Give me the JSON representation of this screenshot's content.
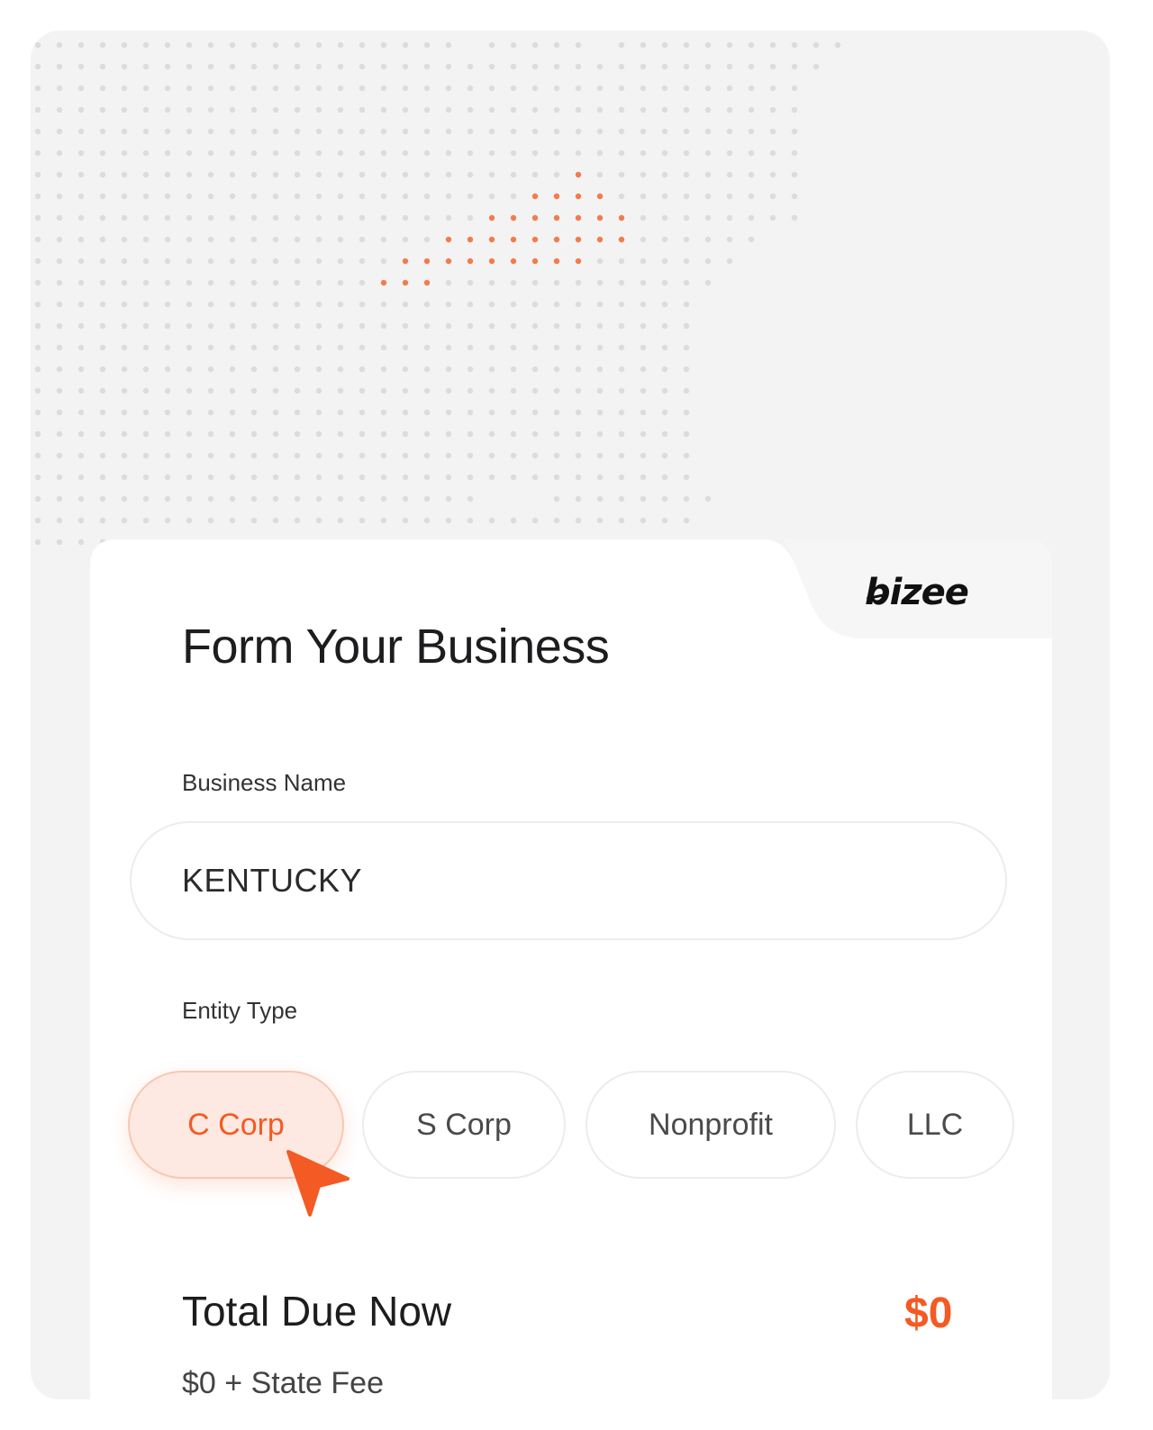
{
  "brand": {
    "logo_text": "bizee"
  },
  "form": {
    "title": "Form Your Business",
    "business_name_label": "Business Name",
    "business_name_value": "KENTUCKY",
    "entity_type_label": "Entity Type",
    "entity_types": [
      {
        "label": "C Corp",
        "selected": true
      },
      {
        "label": "S Corp",
        "selected": false
      },
      {
        "label": "Nonprofit",
        "selected": false
      },
      {
        "label": "LLC",
        "selected": false
      }
    ]
  },
  "total": {
    "label": "Total Due Now",
    "value": "$0",
    "sub_label": "$0 + State Fee"
  },
  "colors": {
    "accent": "#f45a24",
    "dot_gray": "#dcdcdf",
    "dot_highlight": "#f47b4a",
    "selected_chip_bg": "#fde9e1"
  },
  "icons": {
    "cursor": "cursor-arrow-icon"
  }
}
